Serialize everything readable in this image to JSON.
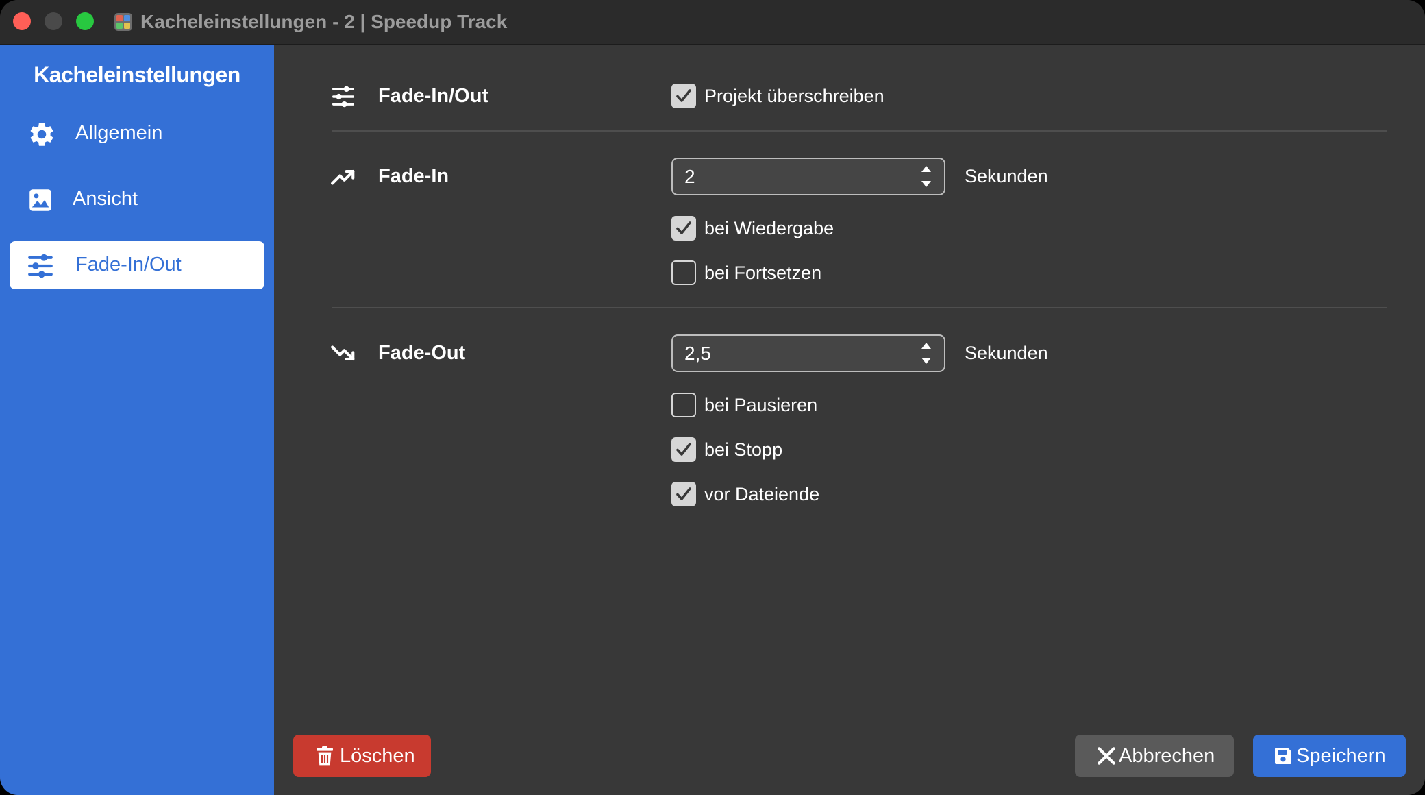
{
  "window": {
    "title": "Kacheleinstellungen - 2 | Speedup Track",
    "app_icon": "tiles-app-icon"
  },
  "sidebar": {
    "title": "Kacheleinstellungen",
    "items": [
      {
        "label": "Allgemein",
        "icon": "gear-icon",
        "active": false
      },
      {
        "label": "Ansicht",
        "icon": "image-icon",
        "active": false
      },
      {
        "label": "Fade-In/Out",
        "icon": "sliders-icon",
        "active": true
      }
    ]
  },
  "sections": {
    "fade_inout": {
      "title": "Fade-In/Out",
      "icon": "sliders-icon",
      "override_project": {
        "label": "Projekt überschreiben",
        "checked": true
      }
    },
    "fade_in": {
      "title": "Fade-In",
      "icon": "trending-up-icon",
      "duration": "2",
      "unit": "Sekunden",
      "on_play": {
        "label": "bei Wiedergabe",
        "checked": true
      },
      "on_resume": {
        "label": "bei Fortsetzen",
        "checked": false
      }
    },
    "fade_out": {
      "title": "Fade-Out",
      "icon": "trending-down-icon",
      "duration": "2,5",
      "unit": "Sekunden",
      "on_pause": {
        "label": "bei Pausieren",
        "checked": false
      },
      "on_stop": {
        "label": "bei Stopp",
        "checked": true
      },
      "before_end": {
        "label": "vor Dateiende",
        "checked": true
      }
    }
  },
  "footer": {
    "delete_label": "Löschen",
    "cancel_label": "Abbrechen",
    "save_label": "Speichern"
  },
  "colors": {
    "sidebar": "#3470d6",
    "content_bg": "#383838",
    "delete": "#c83a2f",
    "cancel": "#5a5a5a",
    "save": "#3470d6"
  }
}
